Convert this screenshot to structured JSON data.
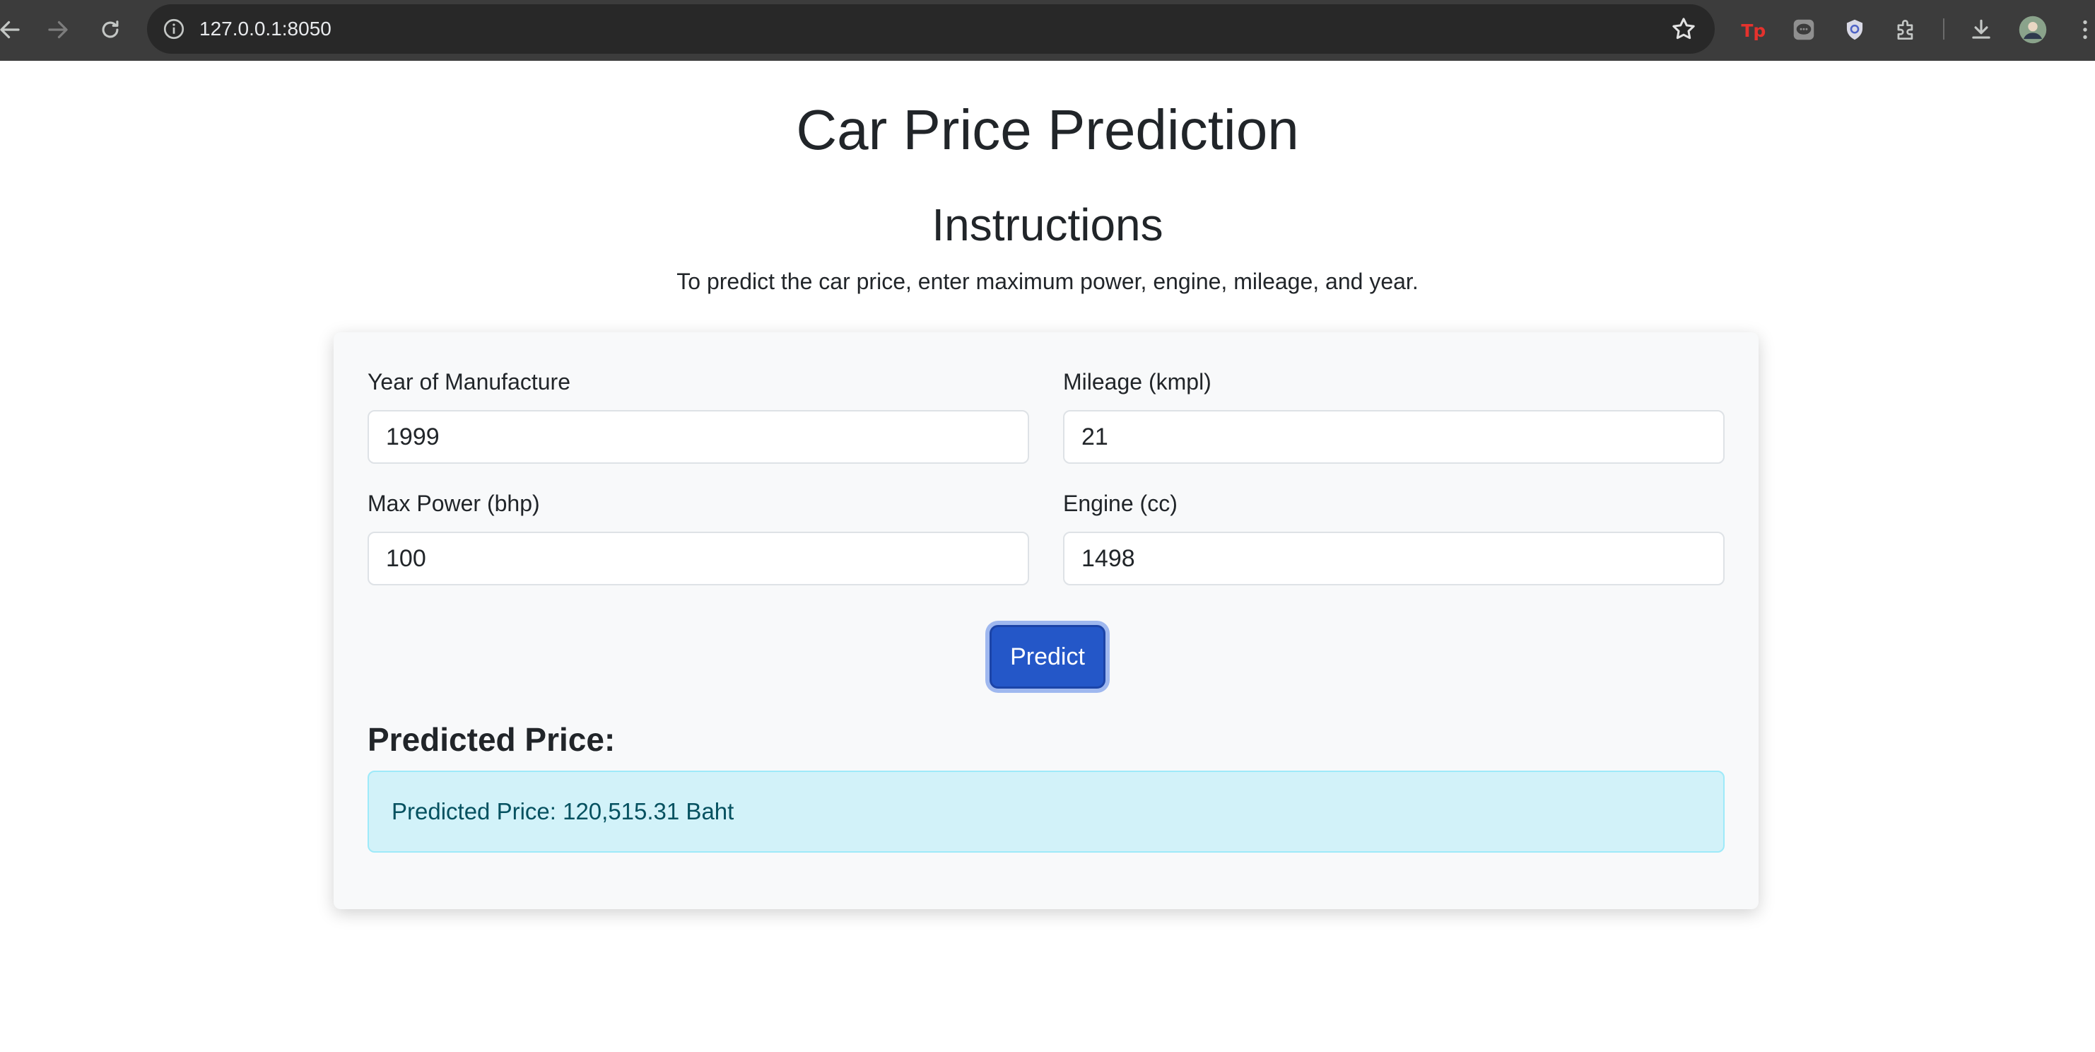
{
  "browser": {
    "url": "127.0.0.1:8050",
    "icons": [
      "back-icon",
      "forward-icon",
      "reload-icon",
      "info-icon",
      "star-icon",
      "tp-extension-icon",
      "chat-extension-icon",
      "shield-extension-icon",
      "puzzle-icon",
      "download-icon",
      "avatar",
      "menu-icon"
    ]
  },
  "page": {
    "title": "Car Price Prediction",
    "instructions_title": "Instructions",
    "instructions_text": "To predict the car price, enter maximum power, engine, mileage, and year."
  },
  "form": {
    "year": {
      "label": "Year of Manufacture",
      "value": "1999"
    },
    "mileage": {
      "label": "Mileage (kmpl)",
      "value": "21"
    },
    "max_power": {
      "label": "Max Power (bhp)",
      "value": "100"
    },
    "engine": {
      "label": "Engine (cc)",
      "value": "1498"
    },
    "predict_label": "Predict"
  },
  "result": {
    "title": "Predicted Price:",
    "text": "Predicted Price: 120,515.31 Baht"
  },
  "colors": {
    "toolbar": "#3c3c3c",
    "omnibox": "#282828",
    "card": "#f8f9fa",
    "button": "#2457c8",
    "alert_bg": "#d2f2f9",
    "alert_text": "#055160"
  }
}
